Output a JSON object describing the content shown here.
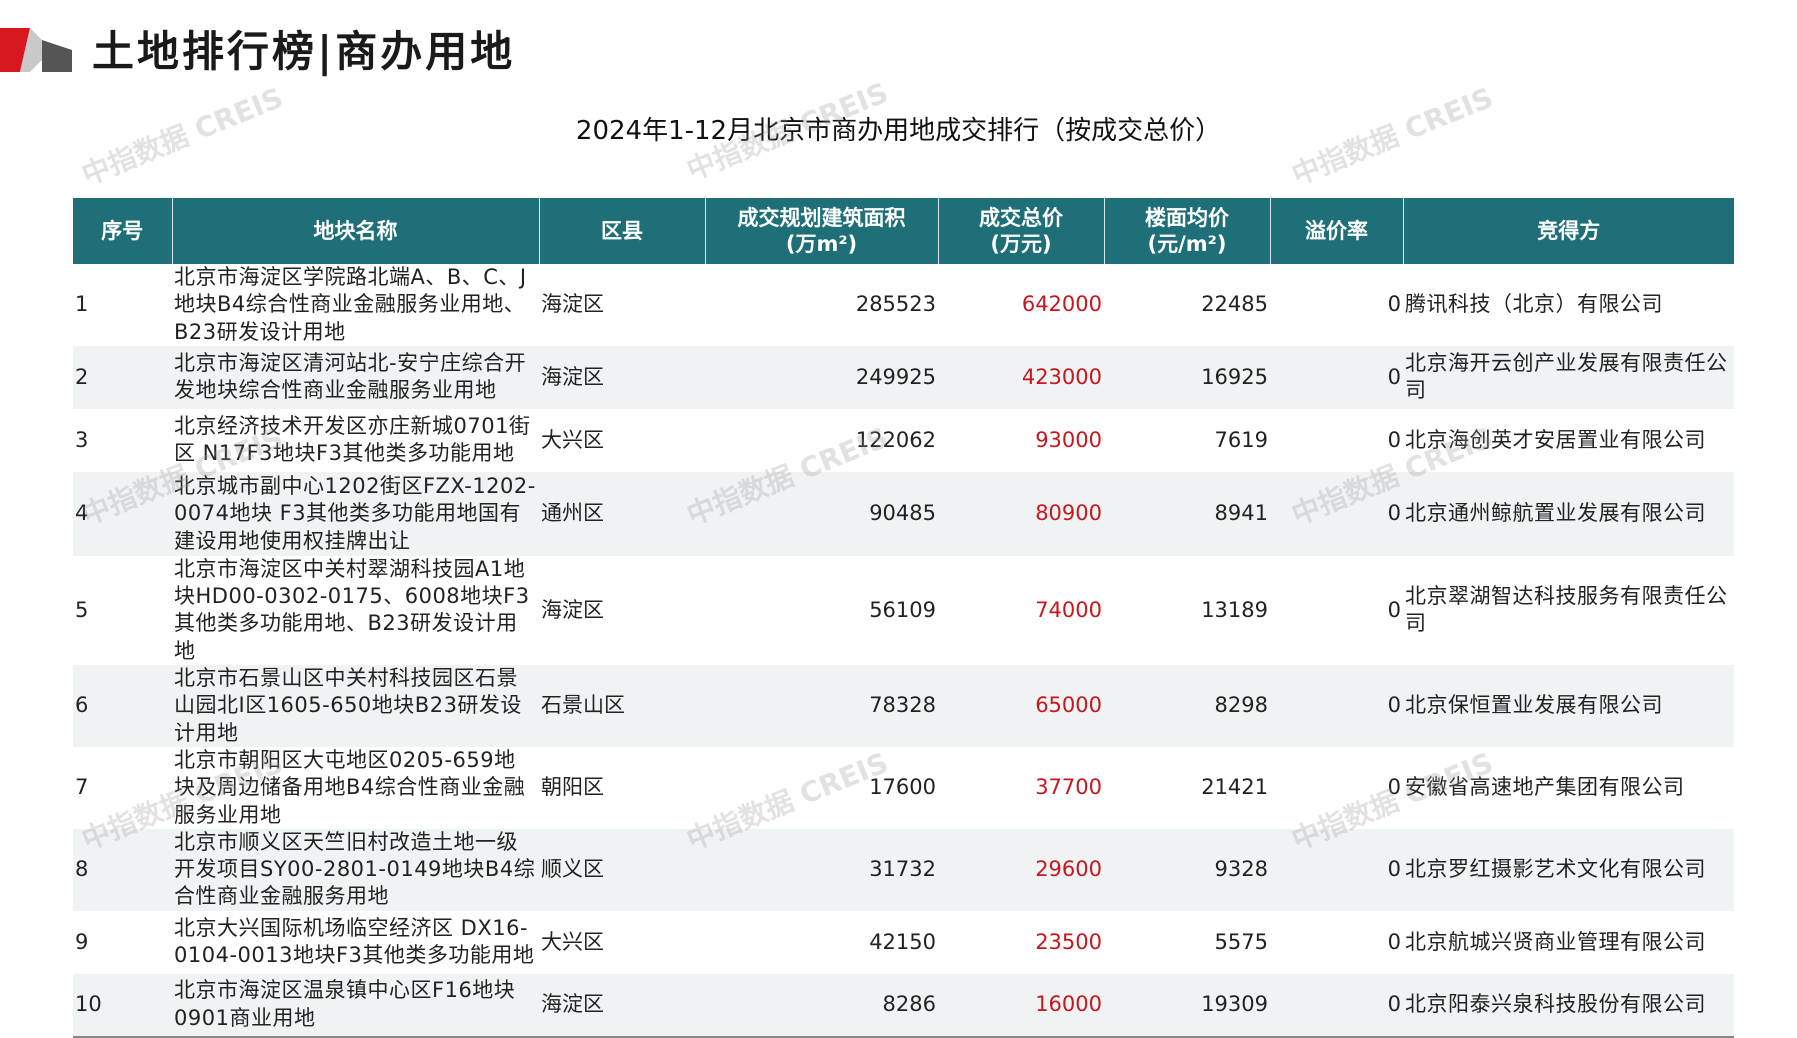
{
  "page": {
    "title": "土地排行榜|商办用地",
    "table_title": "2024年1-12月北京市商办用地成交排行（按成交总价）",
    "watermark": "中指数据 CREIS"
  },
  "colors": {
    "header_bg": "#1e6f77",
    "price_red": "#c8161d",
    "accent_red": "#d7191f"
  },
  "table": {
    "headers": {
      "no": "序号",
      "name": "地块名称",
      "district": "区县",
      "area": "成交规划建筑面积\n(万m²)",
      "price": "成交总价\n(万元)",
      "unit": "楼面均价\n(元/m²)",
      "premium": "溢价率",
      "buyer": "竞得方"
    },
    "rows": [
      {
        "no": "1",
        "name": "北京市海淀区学院路北端A、B、C、J地块B4综合性商业金融服务业用地、B23研发设计用地",
        "district": "海淀区",
        "area": "285523",
        "price": "642000",
        "unit": "22485",
        "premium": "0",
        "buyer": "腾讯科技（北京）有限公司"
      },
      {
        "no": "2",
        "name": "北京市海淀区清河站北-安宁庄综合开发地块综合性商业金融服务业用地",
        "district": "海淀区",
        "area": "249925",
        "price": "423000",
        "unit": "16925",
        "premium": "0",
        "buyer": "北京海开云创产业发展有限责任公司"
      },
      {
        "no": "3",
        "name": "北京经济技术开发区亦庄新城0701街区 N17F3地块F3其他类多功能用地",
        "district": "大兴区",
        "area": "122062",
        "price": "93000",
        "unit": "7619",
        "premium": "0",
        "buyer": "北京海创英才安居置业有限公司"
      },
      {
        "no": "4",
        "name": "北京城市副中心1202街区FZX-1202-0074地块 F3其他类多功能用地国有建设用地使用权挂牌出让",
        "district": "通州区",
        "area": "90485",
        "price": "80900",
        "unit": "8941",
        "premium": "0",
        "buyer": "北京通州鲸航置业发展有限公司"
      },
      {
        "no": "5",
        "name": "北京市海淀区中关村翠湖科技园A1地块HD00-0302-0175、6008地块F3其他类多功能用地、B23研发设计用地",
        "district": "海淀区",
        "area": "56109",
        "price": "74000",
        "unit": "13189",
        "premium": "0",
        "buyer": "北京翠湖智达科技服务有限责任公司"
      },
      {
        "no": "6",
        "name": "北京市石景山区中关村科技园区石景山园北I区1605-650地块B23研发设计用地",
        "district": "石景山区",
        "area": "78328",
        "price": "65000",
        "unit": "8298",
        "premium": "0",
        "buyer": "北京保恒置业发展有限公司"
      },
      {
        "no": "7",
        "name": "北京市朝阳区大屯地区0205-659地块及周边储备用地B4综合性商业金融服务业用地",
        "district": "朝阳区",
        "area": "17600",
        "price": "37700",
        "unit": "21421",
        "premium": "0",
        "buyer": "安徽省高速地产集团有限公司"
      },
      {
        "no": "8",
        "name": "北京市顺义区天竺旧村改造土地一级开发项目SY00-2801-0149地块B4综合性商业金融服务用地",
        "district": "顺义区",
        "area": "31732",
        "price": "29600",
        "unit": "9328",
        "premium": "0",
        "buyer": "北京罗红摄影艺术文化有限公司"
      },
      {
        "no": "9",
        "name": "北京大兴国际机场临空经济区 DX16-0104-0013地块F3其他类多功能用地",
        "district": "大兴区",
        "area": "42150",
        "price": "23500",
        "unit": "5575",
        "premium": "0",
        "buyer": "北京航城兴贤商业管理有限公司"
      },
      {
        "no": "10",
        "name": "北京市海淀区温泉镇中心区F16地块0901商业用地",
        "district": "海淀区",
        "area": "8286",
        "price": "16000",
        "unit": "19309",
        "premium": "0",
        "buyer": "北京阳泰兴泉科技股份有限公司"
      }
    ]
  }
}
